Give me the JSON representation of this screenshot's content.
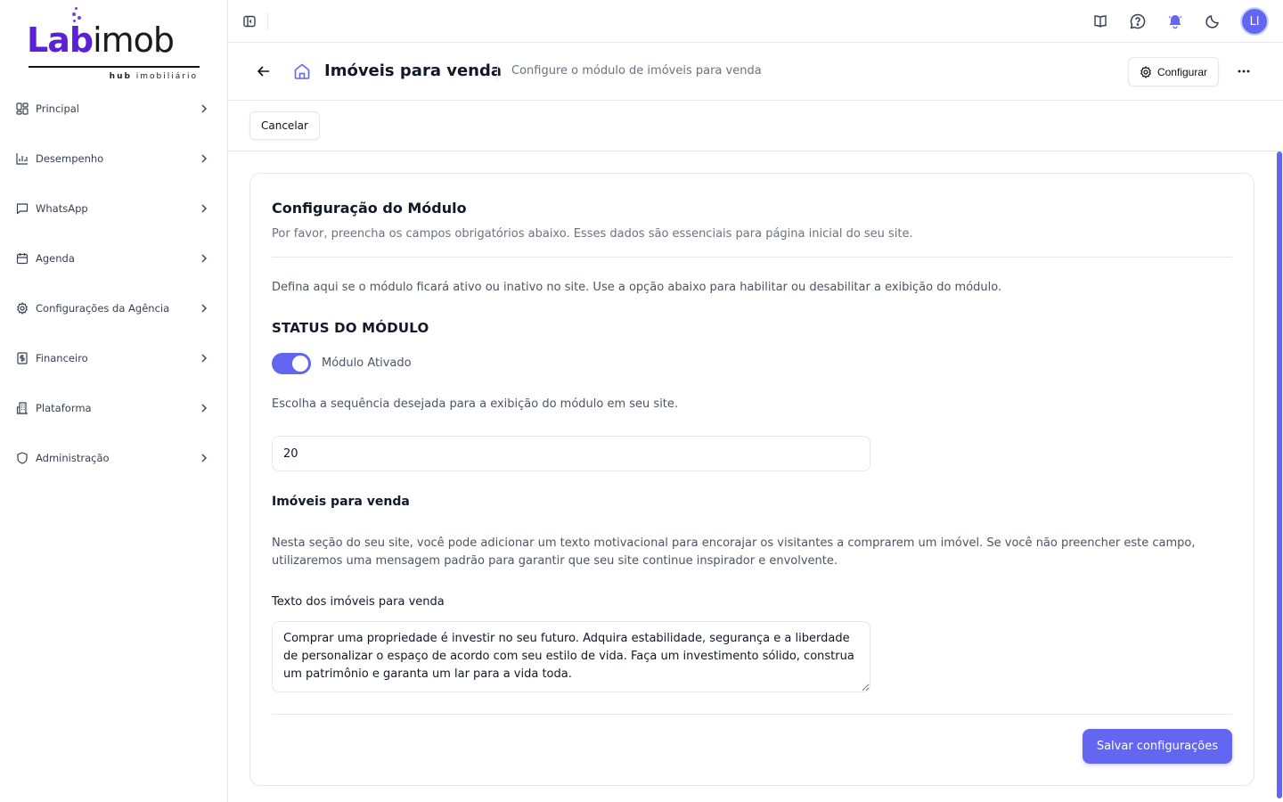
{
  "brand": {
    "logo_part1": "Lab",
    "logo_part2": "imob",
    "logo_sub_bold": "hub",
    "logo_sub": " imobiliário",
    "accent": "#6366f1",
    "logo_color": "#5b21d6"
  },
  "sidebar": {
    "items": [
      {
        "label": "Principal",
        "icon": "grid-icon"
      },
      {
        "label": "Desempenho",
        "icon": "bar-chart-icon"
      },
      {
        "label": "WhatsApp",
        "icon": "chat-icon"
      },
      {
        "label": "Agenda",
        "icon": "calendar-icon"
      },
      {
        "label": "Configurações da Agência",
        "icon": "gear-icon"
      },
      {
        "label": "Financeiro",
        "icon": "dollar-icon"
      },
      {
        "label": "Plataforma",
        "icon": "building-icon"
      },
      {
        "label": "Administração",
        "icon": "shield-icon"
      }
    ]
  },
  "topbar": {
    "avatar_initials": "LI"
  },
  "header": {
    "title": "Imóveis para venda",
    "subtitle": "Configure o módulo de imóveis para venda",
    "config_label": "Configurar"
  },
  "actions": {
    "cancel_label": "Cancelar"
  },
  "card": {
    "title": "Configuração do Módulo",
    "description": "Por favor, preencha os campos obrigatórios abaixo. Esses dados são essenciais para página inicial do seu site.",
    "info": "Defina aqui se o módulo ficará ativo ou inativo no site. Use a opção abaixo para habilitar ou desabilitar a exibição do módulo.",
    "status_label": "STATUS DO MÓDULO",
    "toggle_on": true,
    "toggle_label": "Módulo Ativado",
    "sequence_text": "Escolha a sequência desejada para a exibição do módulo em seu site.",
    "sequence_value": "20",
    "section_title": "Imóveis para venda",
    "section_desc": "Nesta seção do seu site, você pode adicionar um texto motivacional para encorajar os visitantes a comprarem um imóvel. Se você não preencher este campo, utilizaremos uma mensagem padrão para garantir que seu site continue inspirador e envolvente.",
    "textarea_label": "Texto dos imóveis para venda",
    "textarea_value": "Comprar uma propriedade é investir no seu futuro. Adquira estabilidade, segurança e a liberdade de personalizar o espaço de acordo com seu estilo de vida. Faça um investimento sólido, construa um patrimônio e garanta um lar para a vida toda.",
    "save_label": "Salvar configurações"
  }
}
